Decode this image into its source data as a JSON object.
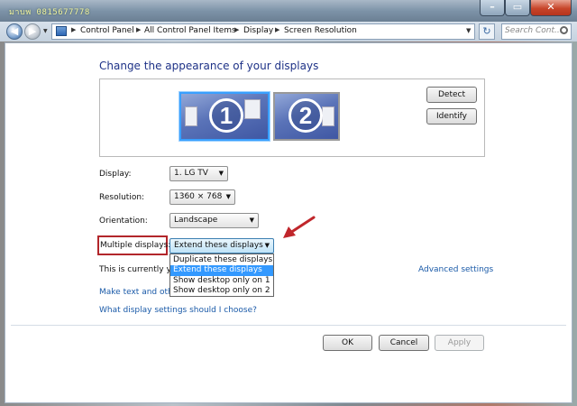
{
  "window": {
    "watermark": "มาบพ 0815677778",
    "minimize_glyph": "–",
    "maximize_glyph": "▭",
    "close_glyph": "✕"
  },
  "nav": {
    "back_glyph": "◀",
    "forward_glyph": "▶",
    "breadcrumbs": [
      "Control Panel",
      "All Control Panel Items",
      "Display",
      "Screen Resolution"
    ],
    "separator_glyph": "▶",
    "dropdown_glyph": "▼",
    "refresh_glyph": "↻",
    "search_placeholder": "Search Cont..."
  },
  "page": {
    "title": "Change the appearance of your displays",
    "monitors": [
      "1",
      "2"
    ],
    "detect_label": "Detect",
    "identify_label": "Identify",
    "display_label": "Display:",
    "display_value": "1. LG TV",
    "resolution_label": "Resolution:",
    "resolution_value": "1360 × 768",
    "orientation_label": "Orientation:",
    "orientation_value": "Landscape",
    "multiple_label": "Multiple displays:",
    "multiple_value": "Extend these displays",
    "multiple_options": [
      "Duplicate these displays",
      "Extend these displays",
      "Show desktop only on 1",
      "Show desktop only on 2"
    ],
    "multiple_selected_index": 1,
    "combo_arrow": "▼",
    "status_text": "This is currently you",
    "advanced_link": "Advanced settings",
    "make_text_link": "Make text and other",
    "which_settings_link": "What display settings should I choose?"
  },
  "footer": {
    "ok_label": "OK",
    "cancel_label": "Cancel",
    "apply_label": "Apply"
  },
  "colors": {
    "link": "#1a5aa8",
    "title": "#1e3287",
    "highlight": "#3399ff",
    "annotation_red": "#b2262b"
  },
  "icons": {
    "search": "search-icon",
    "control_panel": "control-panel-icon",
    "annotation_arrow": "red-arrow-icon"
  }
}
